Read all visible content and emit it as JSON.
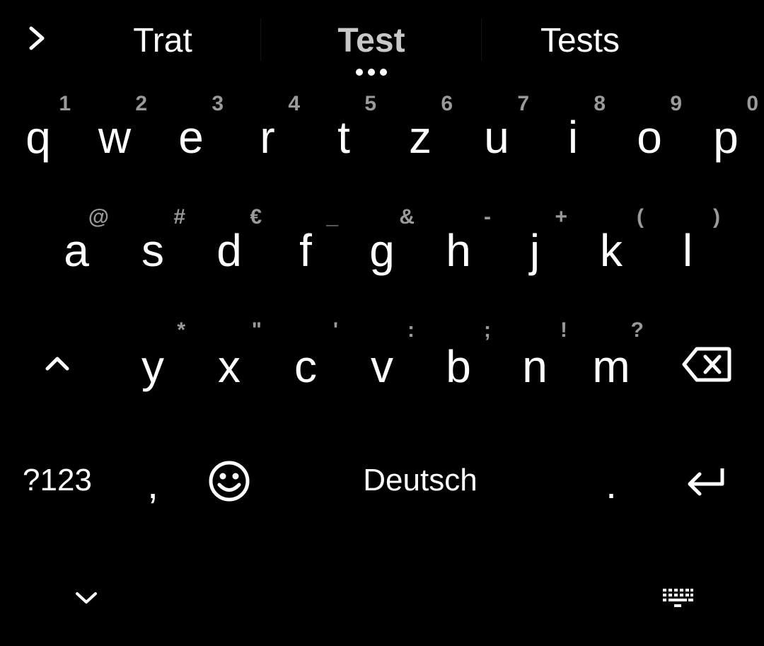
{
  "suggestions": {
    "expand_icon": "chevron-right-icon",
    "left": "Trat",
    "center": "Test",
    "right": "Tests",
    "more_icon": "more-dots-icon"
  },
  "rows": {
    "row1": [
      {
        "label": "q",
        "hint": "1"
      },
      {
        "label": "w",
        "hint": "2"
      },
      {
        "label": "e",
        "hint": "3"
      },
      {
        "label": "r",
        "hint": "4"
      },
      {
        "label": "t",
        "hint": "5"
      },
      {
        "label": "z",
        "hint": "6"
      },
      {
        "label": "u",
        "hint": "7"
      },
      {
        "label": "i",
        "hint": "8"
      },
      {
        "label": "o",
        "hint": "9"
      },
      {
        "label": "p",
        "hint": "0"
      }
    ],
    "row2": [
      {
        "label": "a",
        "hint": "@"
      },
      {
        "label": "s",
        "hint": "#"
      },
      {
        "label": "d",
        "hint": "€"
      },
      {
        "label": "f",
        "hint": "_"
      },
      {
        "label": "g",
        "hint": "&"
      },
      {
        "label": "h",
        "hint": "-"
      },
      {
        "label": "j",
        "hint": "+"
      },
      {
        "label": "k",
        "hint": "("
      },
      {
        "label": "l",
        "hint": ")"
      }
    ],
    "row3": [
      {
        "label": "y",
        "hint": "*"
      },
      {
        "label": "x",
        "hint": "\""
      },
      {
        "label": "c",
        "hint": "'"
      },
      {
        "label": "v",
        "hint": ":"
      },
      {
        "label": "b",
        "hint": ";"
      },
      {
        "label": "n",
        "hint": "!"
      },
      {
        "label": "m",
        "hint": "?"
      }
    ]
  },
  "function_keys": {
    "shift_icon": "shift-caret-icon",
    "backspace_icon": "backspace-icon",
    "symbols_label": "?123",
    "comma_label": ",",
    "emoji_icon": "emoji-smiley-icon",
    "space_label": "Deutsch",
    "period_label": ".",
    "enter_icon": "enter-return-icon"
  },
  "nav_bar": {
    "hide_keyboard_icon": "chevron-down-icon",
    "keyboard_switcher_icon": "keyboard-icon"
  },
  "colors": {
    "background": "#000000",
    "key_text": "#ffffff",
    "hint_text": "#9a9a9a",
    "primary_suggestion": "#c8c8c8"
  }
}
